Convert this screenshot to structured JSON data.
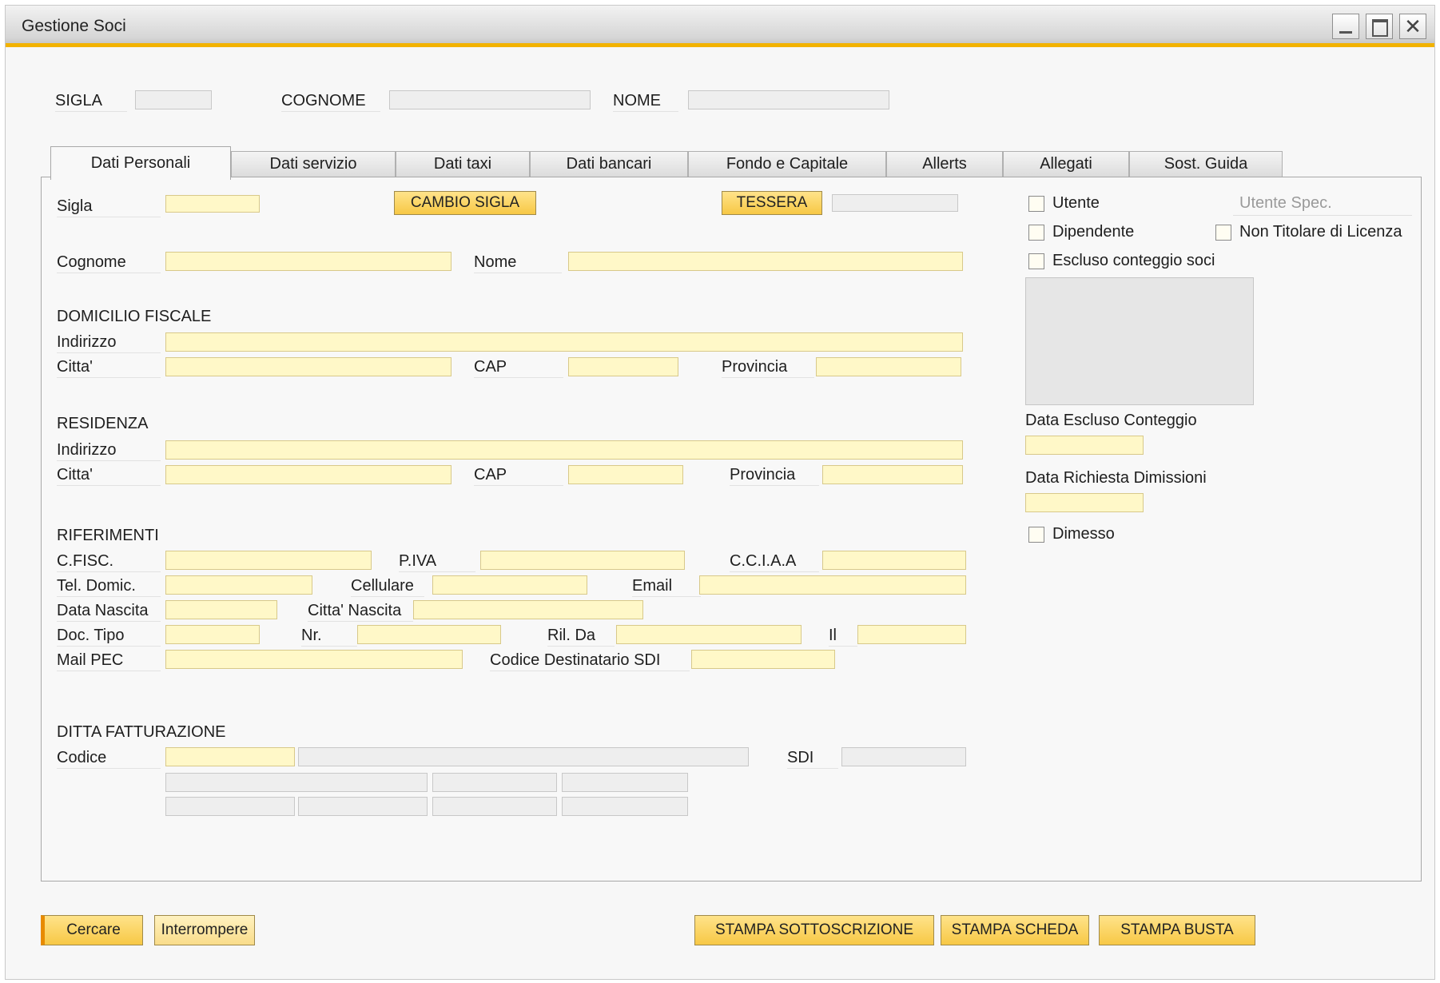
{
  "window": {
    "title": "Gestione Soci"
  },
  "header": {
    "sigla_label": "SIGLA",
    "cognome_label": "COGNOME",
    "nome_label": "NOME"
  },
  "tabs": [
    {
      "label": "Dati Personali",
      "active": true
    },
    {
      "label": "Dati servizio"
    },
    {
      "label": "Dati taxi"
    },
    {
      "label": "Dati bancari"
    },
    {
      "label": "Fondo e Capitale"
    },
    {
      "label": "Allerts"
    },
    {
      "label": "Allegati"
    },
    {
      "label": "Sost. Guida"
    }
  ],
  "personal": {
    "sigla": "Sigla",
    "cambio_sigla": "CAMBIO SIGLA",
    "tessera": "TESSERA",
    "cognome": "Cognome",
    "nome": "Nome"
  },
  "domicilio": {
    "title": "DOMICILIO FISCALE",
    "indirizzo": "Indirizzo",
    "citta": "Citta'",
    "cap": "CAP",
    "provincia": "Provincia"
  },
  "residenza": {
    "title": "RESIDENZA",
    "indirizzo": "Indirizzo",
    "citta": "Citta'",
    "cap": "CAP",
    "provincia": "Provincia"
  },
  "riferimenti": {
    "title": "RIFERIMENTI",
    "cfisc": "C.FISC.",
    "piva": "P.IVA",
    "cciaa": "C.C.I.A.A",
    "tel": "Tel. Domic.",
    "cellulare": "Cellulare",
    "email": "Email",
    "data_nascita": "Data Nascita",
    "citta_nascita": "Citta' Nascita",
    "doc_tipo": "Doc. Tipo",
    "nr": "Nr.",
    "ril_da": "Ril. Da",
    "il": "Il",
    "mail_pec": "Mail PEC",
    "codice_sdi": "Codice Destinatario SDI"
  },
  "ditta": {
    "title": "DITTA FATTURAZIONE",
    "codice": "Codice",
    "sdi": "SDI"
  },
  "side": {
    "utente": "Utente",
    "utente_spec": "Utente Spec.",
    "dipendente": "Dipendente",
    "non_titolare": "Non Titolare di Licenza",
    "escluso": "Escluso conteggio soci",
    "data_escluso": "Data Escluso Conteggio",
    "data_dimissioni": "Data Richiesta Dimissioni",
    "dimesso": "Dimesso"
  },
  "footer": {
    "cercare": "Cercare",
    "interrompere": "Interrompere",
    "stampa_sottoscrizione": "STAMPA SOTTOSCRIZIONE",
    "stampa_scheda": "STAMPA SCHEDA",
    "stampa_busta": "STAMPA BUSTA"
  },
  "icons": {
    "minimize": "minimize-icon",
    "maximize": "maximize-icon",
    "close": "close-icon"
  },
  "colors": {
    "accent": "#f2b200",
    "field_bg": "#fff8c8",
    "button": "#f7c845"
  }
}
